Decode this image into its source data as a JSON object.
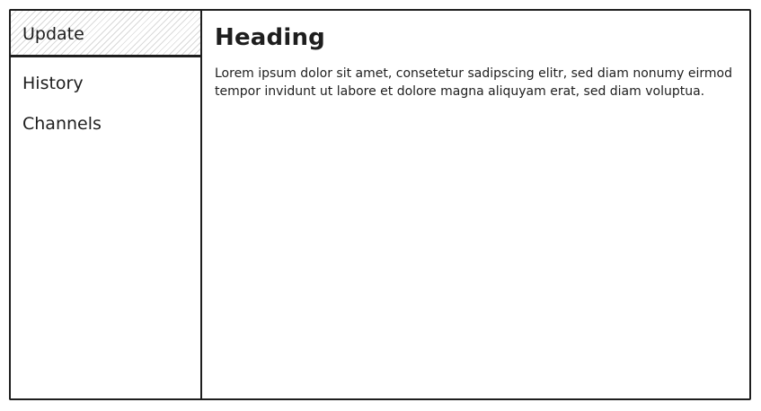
{
  "sidebar": {
    "items": [
      {
        "label": "Update",
        "active": true
      },
      {
        "label": "History",
        "active": false
      },
      {
        "label": "Channels",
        "active": false
      }
    ]
  },
  "main": {
    "heading": "Heading",
    "paragraph": "Lorem ipsum dolor sit amet, consetetur sadipscing elitr, sed diam nonumy eirmod tempor invidunt ut labore et dolore magna aliquyam erat, sed diam voluptua."
  },
  "colors": {
    "stroke": "#1e1e1e",
    "hatch": "#d9d9d9",
    "background": "#ffffff"
  }
}
